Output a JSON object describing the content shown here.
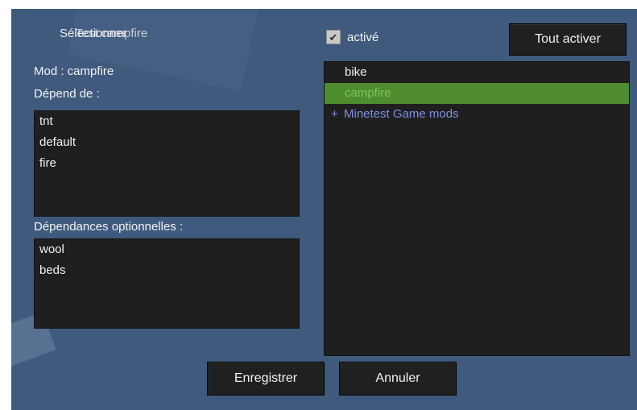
{
  "title": {
    "main": "Sélectionner",
    "overlay": "Test campfire"
  },
  "enabled_checkbox": {
    "checked": true,
    "check_glyph": "✔",
    "label": "activé"
  },
  "buttons": {
    "enable_all": "Tout activer",
    "save": "Enregistrer",
    "cancel": "Annuler"
  },
  "mod_info": {
    "mod_label": "Mod : campfire",
    "depends_label": "Dépend de :",
    "depends": [
      "tnt",
      "default",
      "fire"
    ],
    "optional_label": "Dépendances optionnelles :",
    "optional_depends": [
      "wool",
      "beds"
    ]
  },
  "mod_list": {
    "items": [
      {
        "label": "bike",
        "type": "mod",
        "selected": false
      },
      {
        "label": "campfire",
        "type": "mod",
        "selected": true
      },
      {
        "label": "Minetest Game mods",
        "type": "modpack",
        "prefix": "+",
        "selected": false
      }
    ]
  },
  "colors": {
    "dialog_bg": "#3f5a7d",
    "list_bg": "#1f1f1f",
    "selected_bg": "#4e8c2e",
    "selected_text": "#7cc45a",
    "modpack_text": "#7e8fe6"
  }
}
